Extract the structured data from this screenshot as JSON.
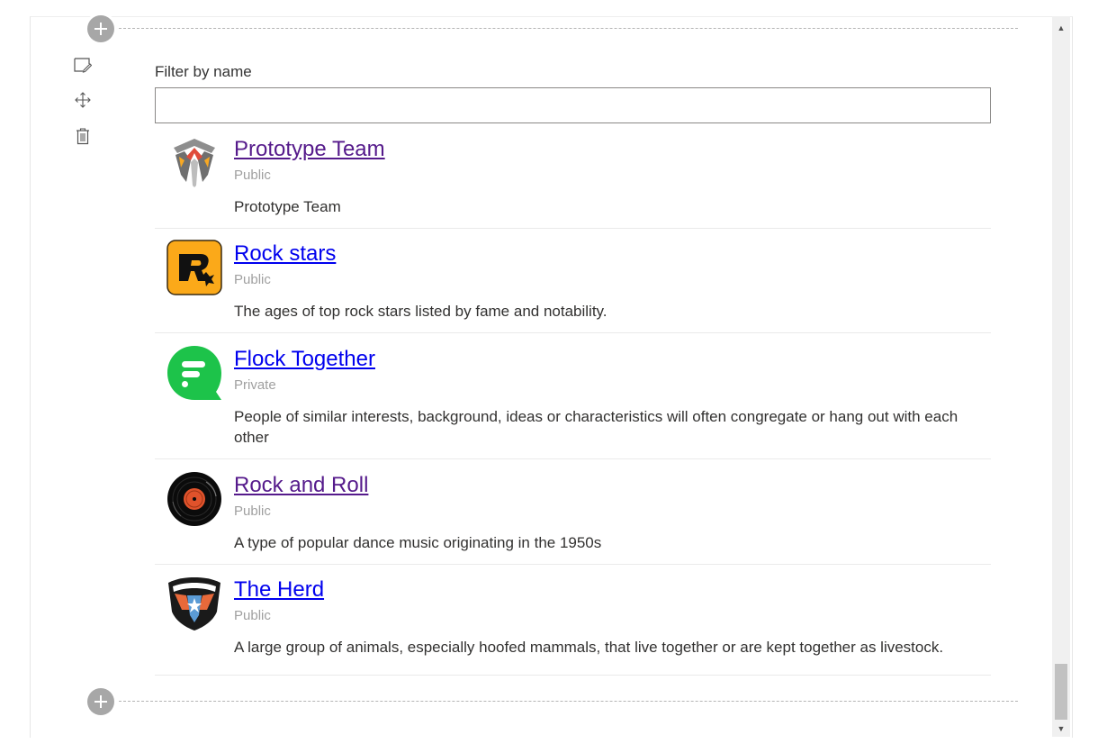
{
  "filter": {
    "label": "Filter by name",
    "value": "",
    "placeholder": ""
  },
  "toolbar": {
    "icons": [
      "edit-icon",
      "move-icon",
      "delete-icon"
    ]
  },
  "groups": [
    {
      "name": "Prototype Team",
      "privacy": "Public",
      "description": "Prototype Team",
      "link_state": "visited",
      "logo": "prototype-team-logo"
    },
    {
      "name": "Rock stars",
      "privacy": "Public",
      "description": "The ages of top rock stars listed by fame and notability.",
      "link_state": "unvisited",
      "logo": "rock-stars-logo"
    },
    {
      "name": "Flock Together",
      "privacy": "Private",
      "description": "People of similar interests, background, ideas or characteristics will often congregate or hang out with each other",
      "link_state": "unvisited",
      "logo": "flock-together-logo"
    },
    {
      "name": "Rock and Roll",
      "privacy": "Public",
      "description": "A type of popular dance music originating in the 1950s",
      "link_state": "visited",
      "logo": "vinyl-record-logo"
    },
    {
      "name": "The Herd",
      "privacy": "Public",
      "description": "A large group of animals, especially hoofed mammals, that live together or are kept together as livestock.",
      "link_state": "unvisited",
      "logo": "bull-shield-logo"
    }
  ],
  "colors": {
    "visited_link": "#551a8b",
    "unvisited_link": "#0000ee",
    "privacy_text": "#a0a0a0",
    "add_button": "#a7a7a7",
    "rock_stars_orange": "#fba919",
    "flock_green": "#1dc34a"
  }
}
